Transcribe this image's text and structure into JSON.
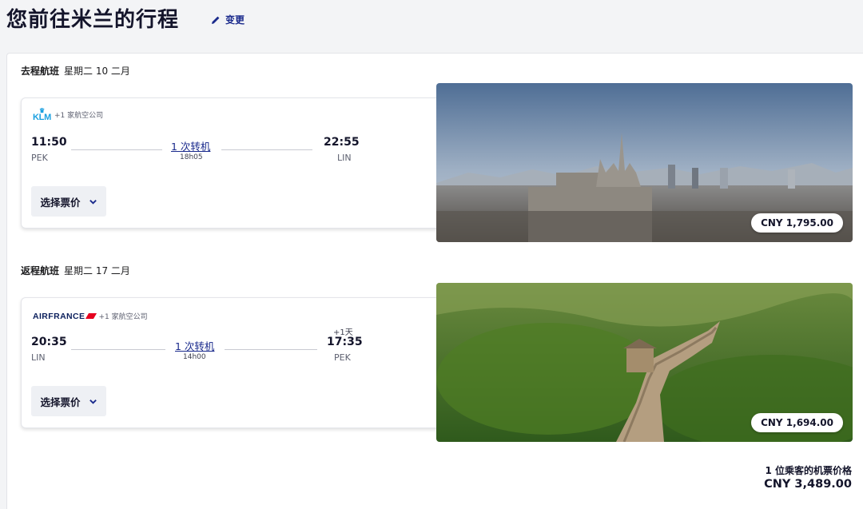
{
  "page": {
    "title": "您前往米兰的行程",
    "edit_label": "变更"
  },
  "outbound": {
    "label": "去程航班",
    "date": "星期二 10 二月",
    "airline": "KLM",
    "partners": "+1 家航空公司",
    "depart_time": "11:50",
    "depart_code": "PEK",
    "stops": "1 次转机",
    "duration": "18h05",
    "arrive_time": "22:55",
    "arrive_code": "LIN",
    "plus_day": "",
    "fare_button": "选择票价",
    "price": "CNY 1,795.00",
    "photo_name": "milan-skyline-photo"
  },
  "return": {
    "label": "返程航班",
    "date": "星期二 17 二月",
    "airline": "AIRFRANCE",
    "partners": "+1 家航空公司",
    "depart_time": "20:35",
    "depart_code": "LIN",
    "stops": "1 次转机",
    "duration": "14h00",
    "arrive_time": "17:35",
    "arrive_code": "PEK",
    "plus_day": "+1天",
    "fare_button": "选择票价",
    "price": "CNY 1,694.00",
    "photo_name": "great-wall-photo"
  },
  "total": {
    "label": "1 位乘客的机票价格",
    "value": "CNY 3,489.00"
  },
  "colors": {
    "link": "#1a2a8c",
    "klm": "#1ba0e0",
    "airfrance_red": "#e5001e"
  }
}
